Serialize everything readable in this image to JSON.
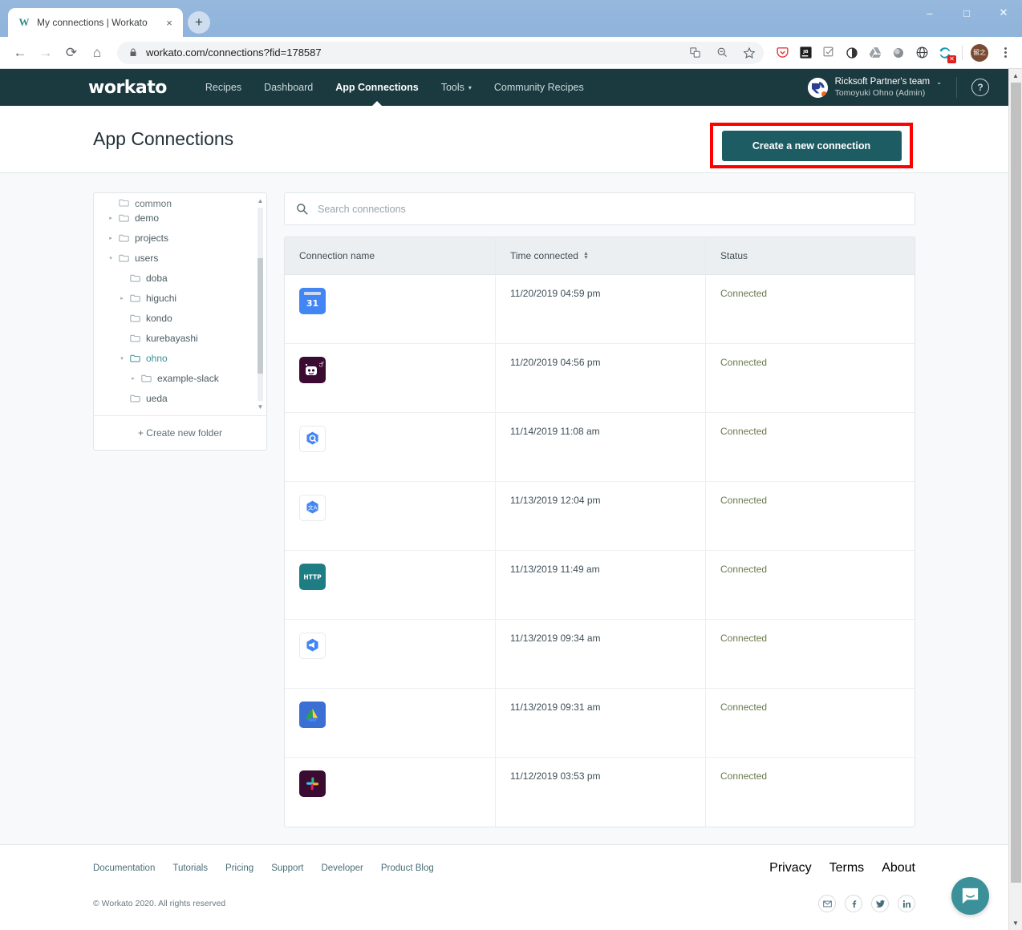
{
  "browser": {
    "tab": {
      "title": "My connections | Workato",
      "favicon": "W",
      "close_label": "×"
    },
    "new_tab_label": "+",
    "window": {
      "minimize": "–",
      "maximize": "□",
      "close": "✕"
    },
    "nav": {
      "back": "←",
      "forward": "→",
      "reload": "⟳",
      "home": "⌂"
    },
    "url": "workato.com/connections?fid=178587",
    "omni_actions": [
      "translate-icon",
      "zoom-out-icon",
      "bookmark-star-icon"
    ],
    "extensions": [
      "pocket-icon",
      "jetbrains-icon",
      "checklist-icon",
      "contrast-icon",
      "google-drive-icon",
      "circle-icon",
      "globe-icon",
      "sync-icon"
    ],
    "profile_initials": "留之",
    "badge": "✕",
    "menu": "⋮"
  },
  "topnav": {
    "logo": "workato",
    "items": [
      {
        "label": "Recipes",
        "active": false,
        "caret": false
      },
      {
        "label": "Dashboard",
        "active": false,
        "caret": false
      },
      {
        "label": "App Connections",
        "active": true,
        "caret": false
      },
      {
        "label": "Tools",
        "active": false,
        "caret": true
      },
      {
        "label": "Community Recipes",
        "active": false,
        "caret": false
      }
    ],
    "caret_glyph": "▾",
    "account": {
      "team": "Ricksoft Partner's team",
      "user": "Tomoyuki Ohno (Admin)",
      "caret": "⌄"
    },
    "help_label": "?"
  },
  "header": {
    "title": "App Connections",
    "create_button": "Create a new connection",
    "highlight_color": "#ff0000"
  },
  "tree": {
    "items": [
      {
        "label": "common",
        "depth": 0,
        "arrow": "",
        "clipped": true,
        "selected": false
      },
      {
        "label": "demo",
        "depth": 0,
        "arrow": "▸",
        "clipped": false,
        "selected": false
      },
      {
        "label": "projects",
        "depth": 0,
        "arrow": "▸",
        "clipped": false,
        "selected": false
      },
      {
        "label": "users",
        "depth": 0,
        "arrow": "▾",
        "clipped": false,
        "selected": false
      },
      {
        "label": "doba",
        "depth": 1,
        "arrow": "",
        "clipped": false,
        "selected": false
      },
      {
        "label": "higuchi",
        "depth": 1,
        "arrow": "▸",
        "clipped": false,
        "selected": false
      },
      {
        "label": "kondo",
        "depth": 1,
        "arrow": "",
        "clipped": false,
        "selected": false
      },
      {
        "label": "kurebayashi",
        "depth": 1,
        "arrow": "",
        "clipped": false,
        "selected": false
      },
      {
        "label": "ohno",
        "depth": 1,
        "arrow": "▾",
        "clipped": false,
        "selected": true
      },
      {
        "label": "example-slack",
        "depth": 2,
        "arrow": "▸",
        "clipped": false,
        "selected": false
      },
      {
        "label": "ueda",
        "depth": 1,
        "arrow": "",
        "clipped": false,
        "selected": false
      }
    ],
    "create_folder": "+ Create new folder",
    "scroll_up": "▲",
    "scroll_down": "▼"
  },
  "search": {
    "placeholder": "Search connections",
    "value": ""
  },
  "table": {
    "columns": [
      "Connection name",
      "Time connected",
      "Status"
    ],
    "sort_column": "Time connected",
    "rows": [
      {
        "icon": "google-calendar-icon",
        "name": "",
        "time": "11/20/2019 04:59 pm",
        "status": "Connected"
      },
      {
        "icon": "workato-bot-icon",
        "name": "",
        "time": "11/20/2019 04:56 pm",
        "status": "Connected"
      },
      {
        "icon": "google-bigquery-icon",
        "name": "",
        "time": "11/14/2019 11:08 am",
        "status": "Connected"
      },
      {
        "icon": "google-cloud-translate-icon",
        "name": "",
        "time": "11/13/2019 12:04 pm",
        "status": "Connected"
      },
      {
        "icon": "http-icon",
        "name": "",
        "time": "11/13/2019 11:49 am",
        "status": "Connected"
      },
      {
        "icon": "google-pubsub-icon",
        "name": "",
        "time": "11/13/2019 09:34 am",
        "status": "Connected"
      },
      {
        "icon": "google-drive-icon",
        "name": "",
        "time": "11/13/2019 09:31 am",
        "status": "Connected"
      },
      {
        "icon": "slack-icon",
        "name": "",
        "time": "11/12/2019 03:53 pm",
        "status": "Connected"
      }
    ]
  },
  "footer": {
    "links": [
      "Documentation",
      "Tutorials",
      "Pricing",
      "Support",
      "Developer",
      "Product Blog"
    ],
    "right_links": [
      "Privacy",
      "Terms",
      "About"
    ],
    "copyright": "© Workato 2020. All rights reserved",
    "social": [
      "email-icon",
      "facebook-icon",
      "twitter-icon",
      "linkedin-icon"
    ]
  },
  "chat": {
    "label": "intercom-chat-icon",
    "color": "#3c9099"
  }
}
